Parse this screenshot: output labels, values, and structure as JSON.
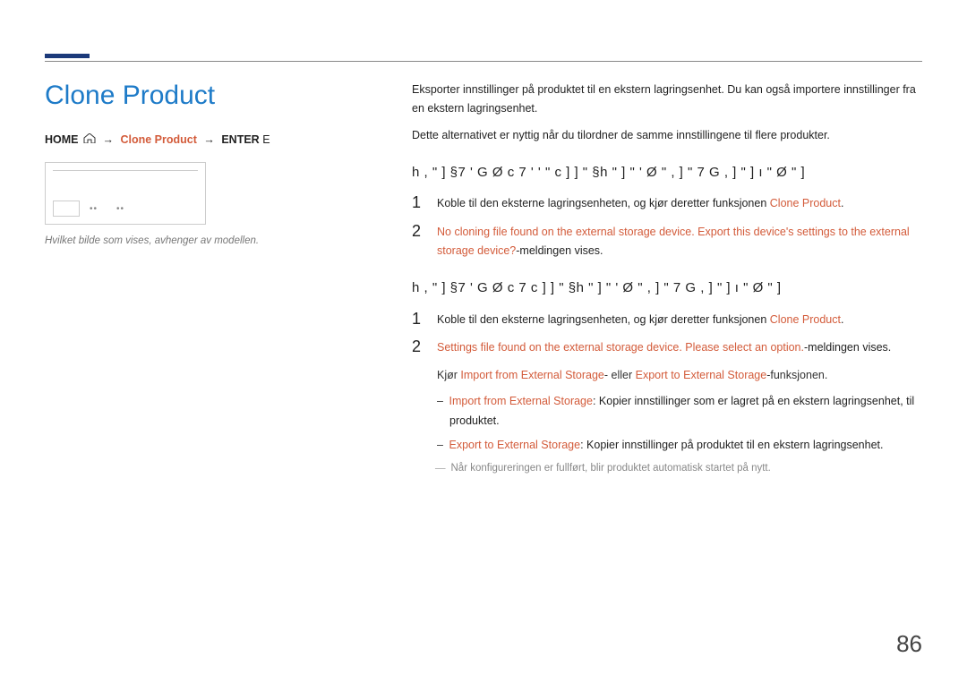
{
  "page_title": "Clone Product",
  "breadcrumb": {
    "home": "HOME",
    "item2": "Clone Product",
    "enter": "ENTER",
    "enter_suffix": "E",
    "arrow": "→"
  },
  "image_caption": "Hvilket bilde som vises, avhenger av modellen.",
  "intro_p1": "Eksporter innstillinger på produktet til en ekstern lagringsenhet. Du kan også importere innstillinger fra en ekstern lagringsenhet.",
  "intro_p2": "Dette alternativet er nyttig når du tilordner de samme innstillingene til flere produkter.",
  "section1": {
    "heading": "h ,   \" ]        §7   ' G Ø c 7      ' ' \"   c ] ] \"       §h      \" ]   \" '   Ø \" , ] \"   7 G    ,    ]       \" ] ı \" Ø \" ]",
    "step1_pre": "Koble til den eksterne lagringsenheten, og kjør deretter funksjonen ",
    "step1_hl": "Clone Product",
    "step1_post": ".",
    "step2_hl": "No cloning file found on the external storage device. Export this device's settings to the external storage device?",
    "step2_post": "-meldingen vises."
  },
  "section2": {
    "heading": "h ,   \" ]        §7   ' G Ø c 7   c ] ] \"       §h      \" ]   \" '   Ø \" , ] \"   7 G    ,    ]       \" ] ı \" Ø \" ]",
    "step1_pre": "Koble til den eksterne lagringsenheten, og kjør deretter funksjonen ",
    "step1_hl": "Clone Product",
    "step1_post": ".",
    "step2_hl": "Settings file found on the external storage device. Please select an option.",
    "step2_post": "-meldingen vises.",
    "kjor_pre": "Kjør ",
    "kjor_hl1": "Import from External Storage",
    "kjor_mid": "- eller ",
    "kjor_hl2": "Export to External Storage",
    "kjor_post": "-funksjonen.",
    "bullet1_hl": "Import from External Storage",
    "bullet1_post": ": Kopier innstillinger som er lagret på en ekstern lagringsenhet, til produktet.",
    "bullet2_hl": "Export to External Storage",
    "bullet2_post": ": Kopier innstillinger på produktet til en ekstern lagringsenhet.",
    "footnote_mark": "―",
    "footnote": "Når konfigureringen er fullført, blir produktet automatisk startet på nytt."
  },
  "page_number": "86"
}
